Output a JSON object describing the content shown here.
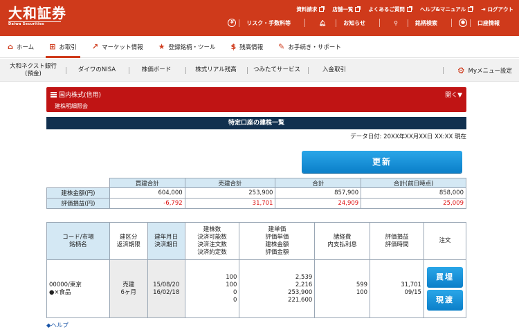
{
  "header": {
    "logo_ja": "大和証券",
    "logo_en": "Daiwa Securities",
    "top_links": [
      "資料請求",
      "店舗一覧",
      "よくあるご質問",
      "ヘルプ&マニュアル",
      "ログアウト"
    ],
    "sub_links": [
      "リスク・手数料等",
      "お知らせ",
      "銘柄検索",
      "口座情報"
    ],
    "color": "#cf3a1b"
  },
  "nav": {
    "items": [
      "ホーム",
      "お取引",
      "マーケット情報",
      "登録銘柄・ツール",
      "残高情報",
      "お手続き・サポート"
    ],
    "active": "お取引"
  },
  "subnav": {
    "items": [
      "大和ネクスト銀行\n(預金)",
      "ダイワのNISA",
      "株価ボード",
      "株式リアル残高",
      "つみたてサービス",
      "入金取引"
    ],
    "mymenu": "Myメニュー設定"
  },
  "banner": {
    "title": "国内株式(信用)",
    "subtitle": "建株明細照会",
    "open_label": "開く▼"
  },
  "section_title": "特定口座の建株一覧",
  "data_date": "データ日付: 20XX年XX月XX日 XX:XX 現在",
  "refresh_label": "更新",
  "summary": {
    "headers": [
      "",
      "買建合計",
      "売建合計",
      "合計",
      "合計(前日時点)"
    ],
    "rows": [
      {
        "label": "建株金額(円)",
        "buy": "604,000",
        "sell": "253,900",
        "total": "857,900",
        "prev": "858,000"
      },
      {
        "label": "評価損益(円)",
        "buy": "-6,792",
        "sell": "31,701",
        "total": "24,909",
        "prev": "25,009"
      }
    ]
  },
  "positions": {
    "headers": {
      "code": "コード/市場\n銘柄名",
      "kubun": "建区分\n返済期限",
      "date": "建年月日\n決済期日",
      "qty": "建株数\n決済可能数\n決済注文数\n決済約定数",
      "price": "建単価\n評価単価\n建株金額\n評価金額",
      "fee": "諸経費\n内支払利息",
      "pl": "評価損益\n評価時間",
      "order": "注文"
    },
    "rows": [
      {
        "code": "00000/東京",
        "name": "●×食品",
        "kubun": "売建\n6ヶ月",
        "dates": "15/08/20\n16/02/18",
        "qty": "100\n100\n0\n0",
        "price": "2,539\n2,216\n253,900\n221,600",
        "fee": "599\n100",
        "pl": "31,701\n09/15",
        "btn_buy": "買埋",
        "btn_settle": "現渡"
      }
    ]
  },
  "help_label": "◆ヘルプ"
}
